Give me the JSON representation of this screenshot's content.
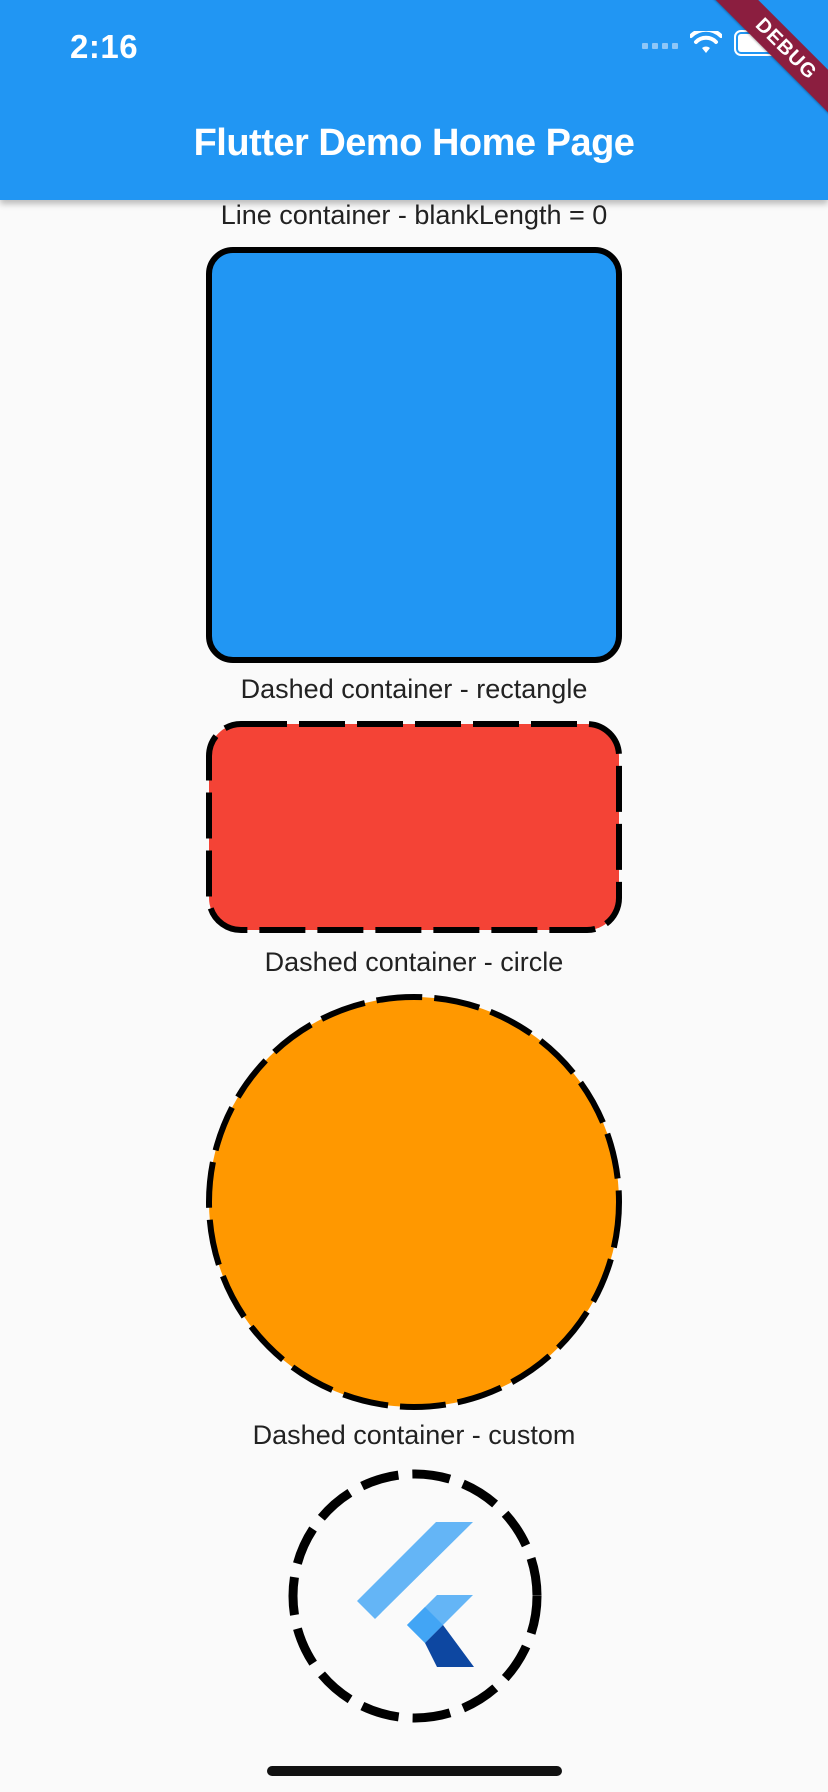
{
  "status_bar": {
    "time": "2:16"
  },
  "app_bar": {
    "title": "Flutter Demo Home Page",
    "color": "#2196f3"
  },
  "debug_banner": {
    "label": "DEBUG",
    "color": "#8b1e3f"
  },
  "sections": [
    {
      "label": "Line container - blankLength = 0",
      "fill": "#2196f3",
      "shape": "rounded-rectangle",
      "border": "solid"
    },
    {
      "label": "Dashed container - rectangle",
      "fill": "#f44336",
      "shape": "rounded-rectangle",
      "border": "dashed"
    },
    {
      "label": "Dashed container - circle",
      "fill": "#ff9800",
      "shape": "circle",
      "border": "dashed"
    },
    {
      "label": "Dashed container - custom",
      "fill": "none",
      "shape": "circle",
      "border": "dashed",
      "content_icon": "flutter-logo-icon"
    }
  ]
}
